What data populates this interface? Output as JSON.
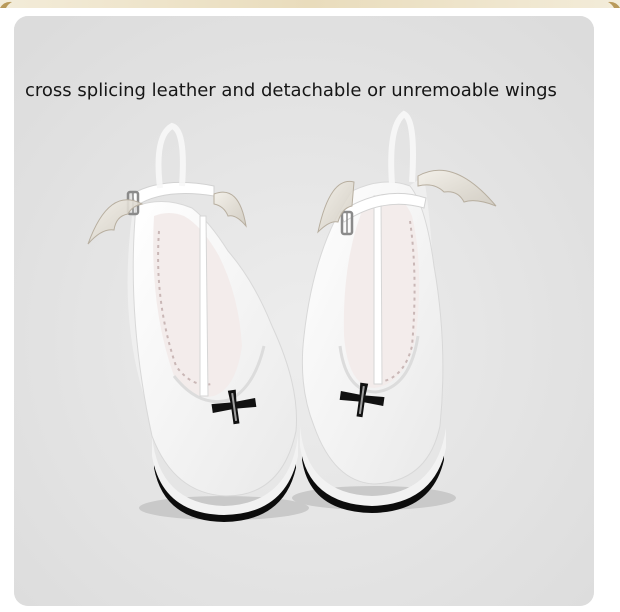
{
  "product": {
    "caption": "cross splicing leather and detachable or unremoable wings",
    "image_alt": "White platform Mary Jane shoes with black cross on the toe and translucent bat wings on the ankle straps"
  },
  "colors": {
    "background": "#e6e6e6",
    "shoe": "#f7f7f7",
    "cross": "#111111",
    "sole": "#0c0c0c",
    "caption_text": "#161616"
  }
}
